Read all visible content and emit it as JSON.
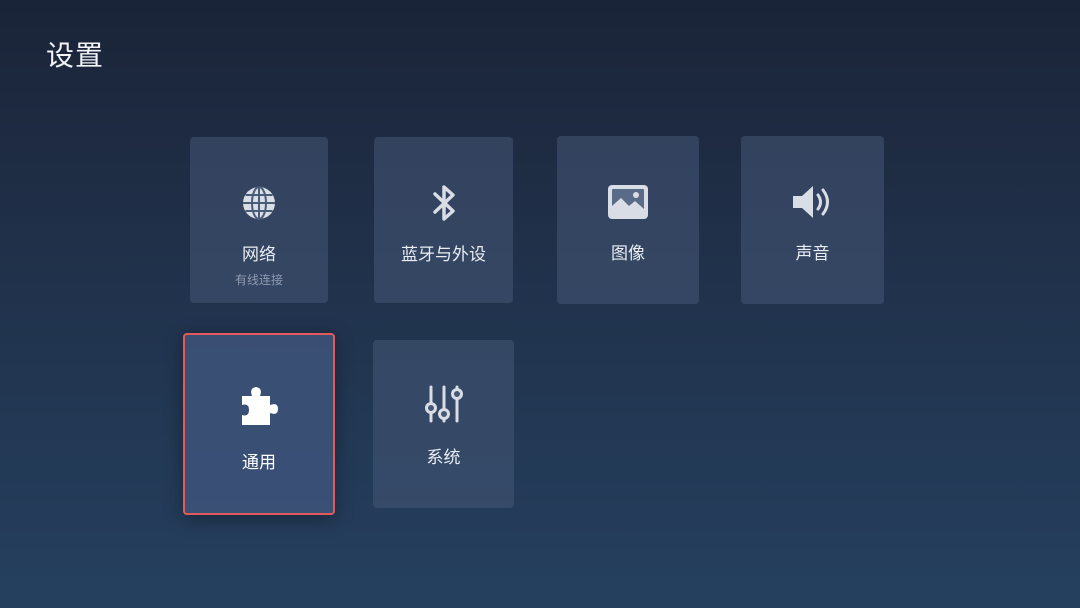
{
  "page": {
    "title": "设置"
  },
  "tiles": [
    {
      "label": "网络",
      "sublabel": "有线连接",
      "icon": "globe-icon"
    },
    {
      "label": "蓝牙与外设",
      "icon": "bluetooth-icon"
    },
    {
      "label": "图像",
      "icon": "image-icon"
    },
    {
      "label": "声音",
      "icon": "speaker-icon"
    },
    {
      "label": "通用",
      "icon": "puzzle-icon",
      "focused": true
    },
    {
      "label": "系统",
      "icon": "sliders-icon"
    }
  ],
  "colors": {
    "focus_border": "#e45a5a",
    "tile_bg": "#465876",
    "label": "#e9edf3",
    "sublabel": "#8f9bb0"
  }
}
